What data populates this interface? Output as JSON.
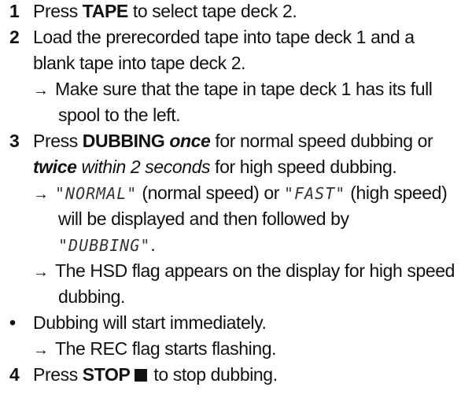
{
  "steps": [
    {
      "number": "1",
      "prefix": "Press ",
      "key": "TAPE",
      "suffix": " to select tape deck 2."
    },
    {
      "number": "2",
      "lines": [
        "Load the prerecorded tape into tape deck 1 and a",
        "blank tape into tape deck 2."
      ],
      "notes": [
        {
          "arrow": "→",
          "lines": [
            "Make sure that the tape in tape deck 1 has its full",
            "spool to the left."
          ]
        }
      ]
    },
    {
      "number": "3",
      "line1": {
        "prefix": "Press ",
        "key": "DUBBING",
        "once": "once",
        "suffix": " for normal speed dubbing or"
      },
      "line2": {
        "twice": "twice",
        "within": " within 2 seconds",
        "suffix": " for high speed dubbing."
      },
      "notes": [
        {
          "arrow": "→",
          "display_normal": "\"NORMAL\"",
          "text_a": " (normal speed) or ",
          "display_fast": "\"FAST\"",
          "text_b": " (high speed)",
          "line2": "will be displayed and then followed by",
          "display_dubbing": "\"DUBBING\"",
          "end": "."
        },
        {
          "arrow": "→",
          "lines": [
            "The HSD flag appears on the display for high speed",
            "dubbing."
          ]
        }
      ]
    },
    {
      "bullet": "•",
      "text": "Dubbing will start immediately.",
      "notes": [
        {
          "arrow": "→",
          "text": "The REC flag starts flashing."
        }
      ]
    },
    {
      "number": "4",
      "prefix": "Press ",
      "key": "STOP",
      "symbol_icon": "stop-square-icon",
      "suffix": "to stop dubbing."
    }
  ]
}
